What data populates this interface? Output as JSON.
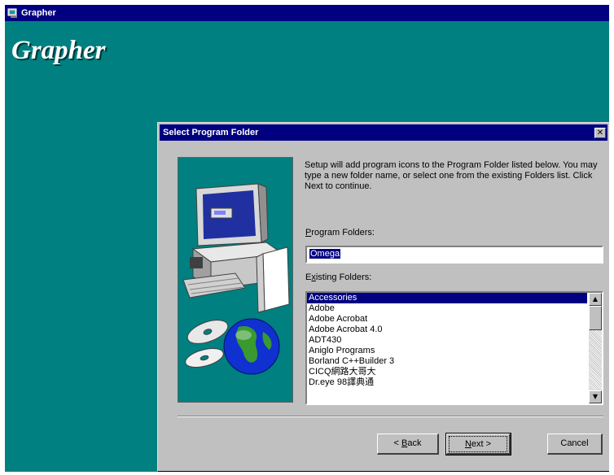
{
  "app": {
    "window_title": "Grapher",
    "heading": "Grapher"
  },
  "dialog": {
    "title": "Select Program Folder",
    "description": "Setup will add program icons to the Program Folder listed below. You may type a new folder name, or select one from the existing Folders list.  Click Next to continue.",
    "program_folders_label_hotkey": "P",
    "program_folders_label_rest": "rogram Folders:",
    "program_folder_value": "Omega",
    "existing_folders_label_first": "E",
    "existing_folders_label_hotkey": "x",
    "existing_folders_label_rest": "isting Folders:",
    "existing_folders": [
      "Accessories",
      "Adobe",
      "Adobe Acrobat",
      "Adobe Acrobat 4.0",
      "ADT430",
      "Aniglo Programs",
      "Borland C++Builder 3",
      "CICQ網路大哥大",
      "Dr.eye 98譯典通"
    ],
    "selected_index": 0,
    "buttons": {
      "back_prefix": "< ",
      "back_hotkey": "B",
      "back_rest": "ack",
      "next_hotkey": "N",
      "next_rest": "ext >",
      "cancel": "Cancel"
    }
  },
  "colors": {
    "desktop": "#008080",
    "titlebar": "#000080",
    "dialog_face": "#c0c0c0",
    "selection": "#000080"
  }
}
